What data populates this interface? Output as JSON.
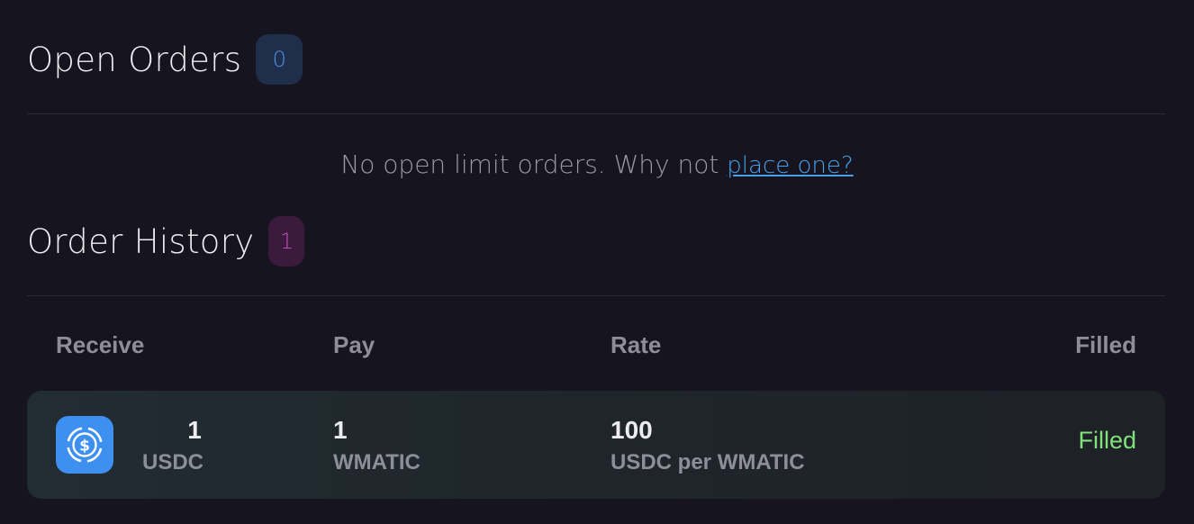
{
  "open_orders": {
    "title": "Open Orders",
    "count": "0",
    "empty_text": "No open limit orders. Why not ",
    "empty_link": "place one?"
  },
  "order_history": {
    "title": "Order History",
    "count": "1",
    "columns": [
      "Receive",
      "Pay",
      "Rate",
      "Filled"
    ],
    "rows": [
      {
        "receive_amount": "1",
        "receive_token": "USDC",
        "receive_icon": "usdc-icon",
        "pay_amount": "1",
        "pay_token": "WMATIC",
        "rate_value": "100",
        "rate_unit": "USDC per WMATIC",
        "status": "Filled"
      }
    ]
  },
  "colors": {
    "background": "#15141f",
    "badge_blue": "#4a90e2",
    "badge_pink": "#c44bb5",
    "link": "#4a9fe8",
    "filled_green": "#7fe27a",
    "usdc_blue": "#3d8ff0"
  }
}
